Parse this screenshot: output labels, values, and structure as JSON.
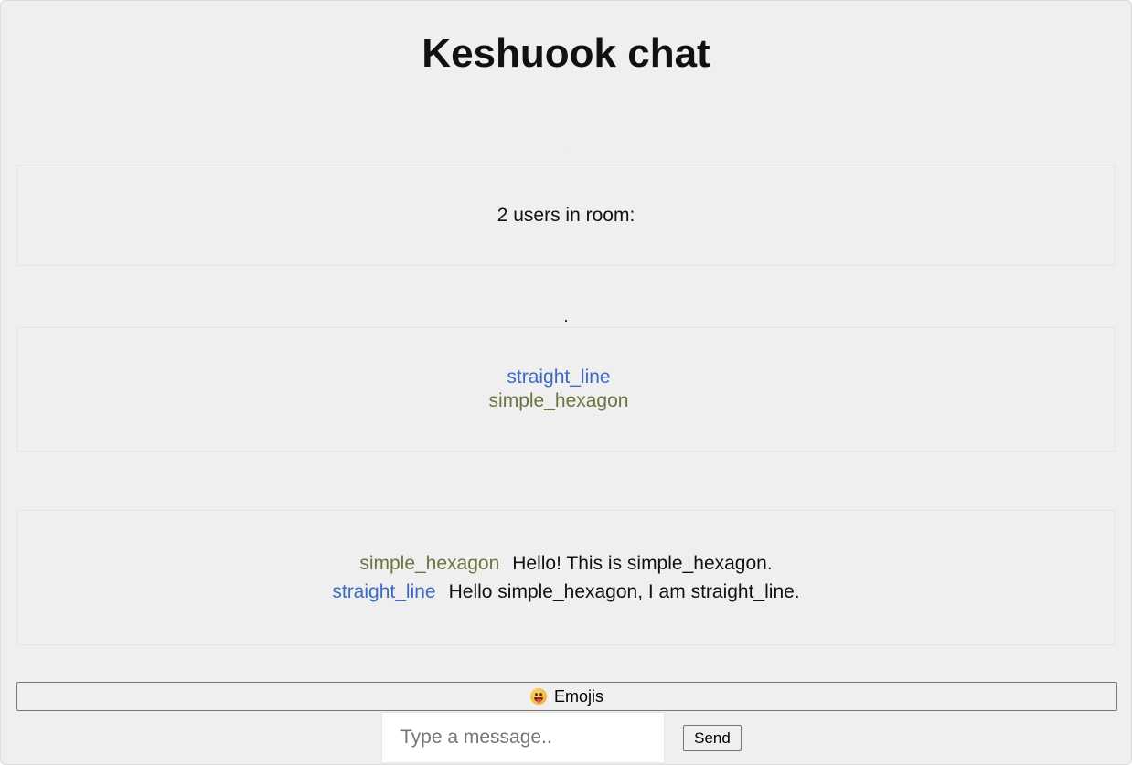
{
  "header": {
    "title": "Keshuook chat"
  },
  "separators": {
    "faint_dot": ".",
    "dark_dot": "."
  },
  "room": {
    "user_count_text": "2 users in room:"
  },
  "users": [
    {
      "name": "straight_line",
      "color": "#3b6bc4"
    },
    {
      "name": "simple_hexagon",
      "color": "#6e7440"
    }
  ],
  "messages": [
    {
      "user": "simple_hexagon",
      "text": "Hello! This is simple_hexagon.",
      "color": "#6e7440"
    },
    {
      "user": "straight_line",
      "text": "Hello simple_hexagon, I am straight_line.",
      "color": "#3b6bc4"
    }
  ],
  "composer": {
    "emoji_button_label": "Emojis",
    "emoji_icon": "grinning-face-with-tongue-icon",
    "input_placeholder": "Type a message..",
    "input_value": "",
    "send_label": "Send"
  },
  "colors": {
    "background": "#efefef",
    "user_straight_line": "#3b6bc4",
    "user_simple_hexagon": "#6e7440"
  }
}
